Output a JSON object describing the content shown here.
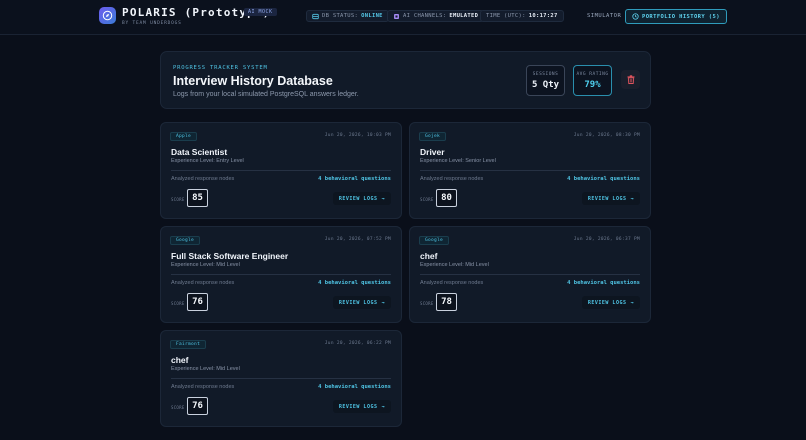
{
  "header": {
    "brand": "POLARIS (Prototype)",
    "brand_badge": "AI MOCK",
    "brand_sub": "BY TEAM UNDERDOGS",
    "db_status_label": "DB STATUS:",
    "db_status_value": "ONLINE",
    "ai_channels_label": "AI CHANNELS:",
    "ai_channels_value": "EMULATED",
    "time_label": "TIME (UTC):",
    "time_value": "10:17:27",
    "nav_simulator": "SIMULATOR",
    "nav_portfolio": "PORTFOLIO HISTORY (5)"
  },
  "hero": {
    "kicker": "PROGRESS TRACKER SYSTEM",
    "title": "Interview History Database",
    "subtitle": "Logs from your local simulated PostgreSQL answers ledger.",
    "sessions_label": "SESSIONS",
    "sessions_value": "5 Qty",
    "avg_label": "AVG RATING",
    "avg_value": "79%"
  },
  "labels": {
    "nodes_label": "Analyzed response nodes",
    "score_label": "SCORE",
    "review_label": "REVIEW LOGS"
  },
  "sessions": [
    {
      "company": "Apple",
      "date": "Jun 20, 2026, 10:03 PM",
      "role": "Data Scientist",
      "level": "Experience Level: Entry Level",
      "questions": "4 behavioral questions",
      "score": "85"
    },
    {
      "company": "Gojek",
      "date": "Jun 20, 2026, 08:30 PM",
      "role": "Driver",
      "level": "Experience Level: Senior Level",
      "questions": "4 behavioral questions",
      "score": "80"
    },
    {
      "company": "Google",
      "date": "Jun 20, 2026, 07:52 PM",
      "role": "Full Stack Software Engineer",
      "level": "Experience Level: Mid Level",
      "questions": "4 behavioral questions",
      "score": "76"
    },
    {
      "company": "Google",
      "date": "Jun 20, 2026, 06:37 PM",
      "role": "chef",
      "level": "Experience Level: Mid Level",
      "questions": "4 behavioral questions",
      "score": "78"
    },
    {
      "company": "Fairmont",
      "date": "Jun 20, 2026, 06:22 PM",
      "role": "chef",
      "level": "Experience Level: Mid Level",
      "questions": "4 behavioral questions",
      "score": "76"
    }
  ]
}
